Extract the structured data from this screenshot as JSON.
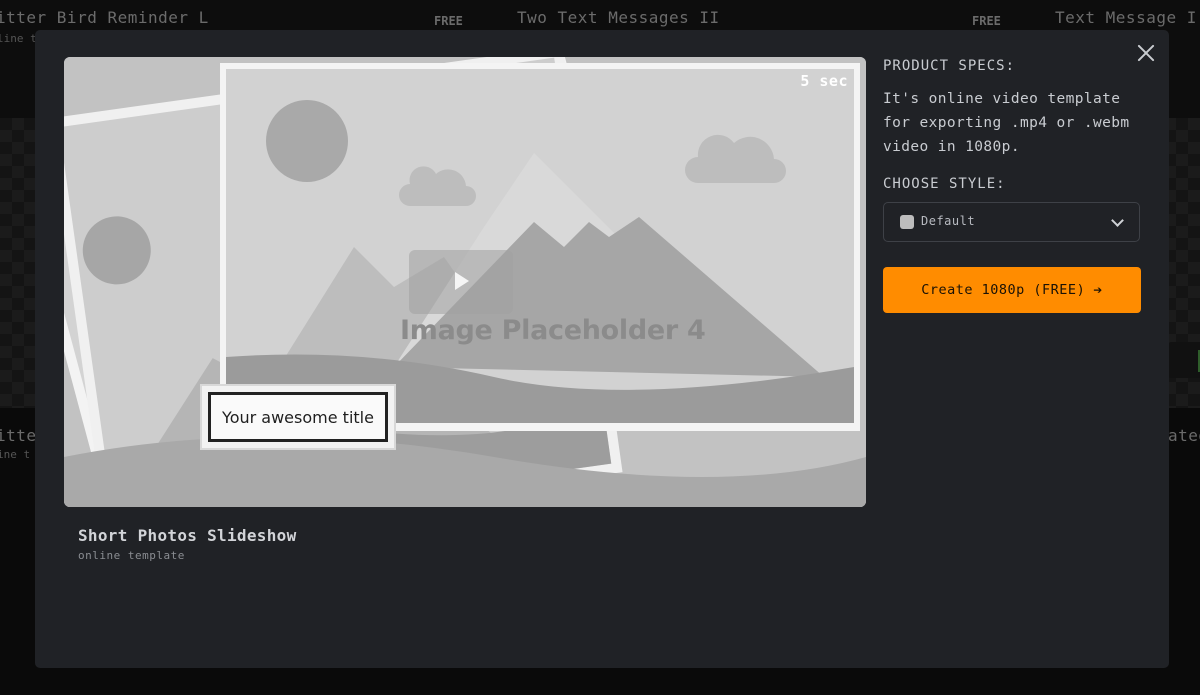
{
  "background": {
    "cards_top": [
      {
        "title": "itter Bird Reminder L",
        "subtitle": "line t",
        "badge": "FREE"
      },
      {
        "title": "Two Text Messages II",
        "badge": "FREE"
      },
      {
        "title": "Text Message I"
      }
    ],
    "cards_bottom": [
      {
        "title": "itter",
        "subtitle": "ine t"
      },
      {
        "title": "ated"
      }
    ]
  },
  "modal": {
    "preview": {
      "duration": "5 sec",
      "placeholder_text": "Image Placeholder 4",
      "title_overlay": "Your awesome title"
    },
    "template": {
      "name": "Short Photos Slideshow",
      "subtitle": "online template"
    },
    "specs": {
      "heading": "PRODUCT SPECS:",
      "description": "It's online video template for exporting .mp4 or .webm video in 1080p."
    },
    "style": {
      "heading": "CHOOSE STYLE:",
      "selected": "Default",
      "swatch_color": "#bdbdbd"
    },
    "cta": {
      "label": "Create 1080p (FREE)"
    }
  },
  "colors": {
    "accent": "#ff8c00",
    "modal_bg": "#202226",
    "backdrop": "#0a0a0a"
  }
}
